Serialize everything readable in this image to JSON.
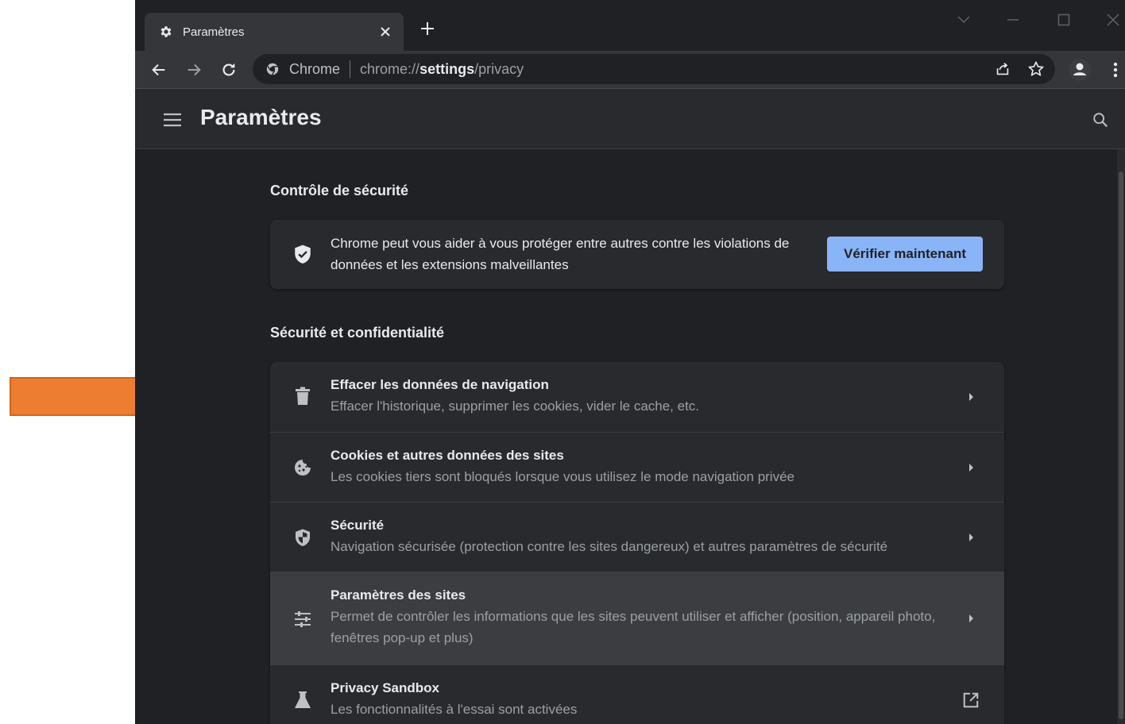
{
  "tab": {
    "title": "Paramètres",
    "favicon": "gear-icon"
  },
  "omnibox": {
    "chip": "Chrome",
    "url_scheme": "chrome://",
    "url_host": "settings",
    "url_path": "/privacy"
  },
  "header": {
    "title": "Paramètres"
  },
  "safety_check": {
    "title": "Contrôle de sécurité",
    "description": "Chrome peut vous aider à vous protéger entre autres contre les violations de données et les extensions malveillantes",
    "button_label": "Vérifier maintenant"
  },
  "privacy": {
    "title": "Sécurité et confidentialité",
    "items": [
      {
        "title": "Effacer les données de navigation",
        "subtitle": "Effacer l'historique, supprimer les cookies, vider le cache, etc.",
        "icon": "trash-icon"
      },
      {
        "title": "Cookies et autres données des sites",
        "subtitle": "Les cookies tiers sont bloqués lorsque vous utilisez le mode navigation privée",
        "icon": "cookie-icon"
      },
      {
        "title": "Sécurité",
        "subtitle": "Navigation sécurisée (protection contre les sites dangereux) et autres paramètres de sécurité",
        "icon": "shield-icon"
      },
      {
        "title": "Paramètres des sites",
        "subtitle": "Permet de contrôler les informations que les sites peuvent utiliser et afficher (position, appareil photo, fenêtres pop-up et plus)",
        "icon": "tune-icon"
      },
      {
        "title": "Privacy Sandbox",
        "subtitle": "Les fonctionnalités à l'essai sont activées",
        "icon": "flask-icon"
      }
    ]
  },
  "colors": {
    "annotation_arrow": "#ed7d31",
    "accent": "#8ab4f8",
    "background": "#202124"
  }
}
